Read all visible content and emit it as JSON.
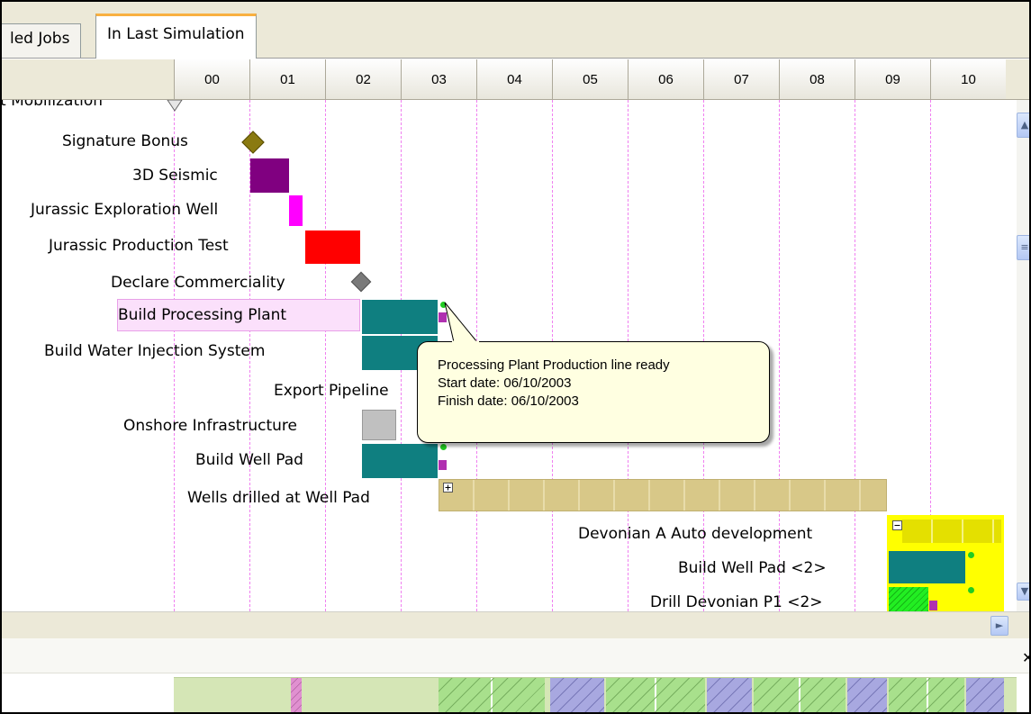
{
  "tabs": [
    {
      "label": "led Jobs",
      "active": false
    },
    {
      "label": "In Last Simulation",
      "active": true
    }
  ],
  "timeline": {
    "years": [
      "00",
      "01",
      "02",
      "03",
      "04",
      "05",
      "06",
      "07",
      "08",
      "09",
      "10"
    ]
  },
  "tasks": {
    "mobilization": "t Mobilization",
    "signature_bonus": "Signature Bonus",
    "seismic": "3D Seismic",
    "exploration_well": "Jurassic Exploration Well",
    "production_test": "Jurassic Production Test",
    "commerciality": "Declare Commerciality",
    "processing_plant": "Build Processing Plant",
    "water_injection": "Build Water Injection System",
    "export_pipeline": "Export Pipeline",
    "onshore": "Onshore Infrastructure",
    "well_pad": "Build Well Pad",
    "wells_drilled": "Wells drilled at Well Pad",
    "devonian_auto": "Devonian A Auto development",
    "well_pad_2": "Build Well Pad <2>",
    "drill_devonian": "Drill Devonian P1 <2>"
  },
  "tooltip": {
    "line1": "Processing Plant Production line ready",
    "line2": "Start date: 06/10/2003",
    "line3": "Finish date: 06/10/2003"
  },
  "colors": {
    "teal": "#0f7f80",
    "purple": "#800080",
    "magenta": "#ff00ff",
    "red": "#ff0000",
    "gray": "#c0c0c0",
    "khaki": "#d8c888",
    "yellow": "#ffff00",
    "green": "#22ee22"
  },
  "icons": {
    "expand": "plus-box-icon",
    "collapse": "minus-box-icon",
    "scroll_right": "arrow-right-icon",
    "close": "close-icon"
  }
}
